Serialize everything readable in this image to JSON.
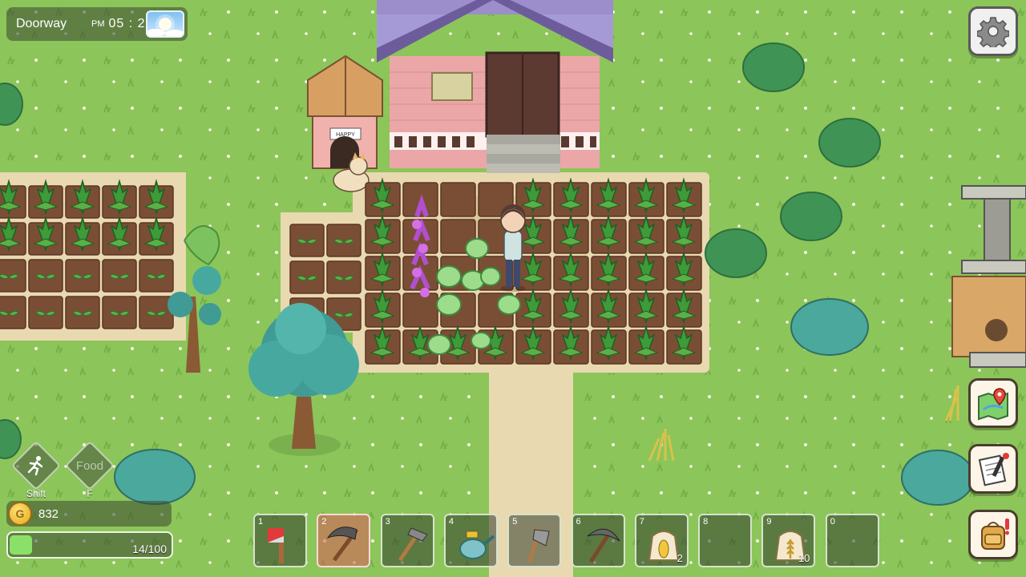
{
  "hud": {
    "location": "Doorway",
    "ampm": "PM",
    "time": "05 : 20",
    "weather_icon": "sunny-icon",
    "gold": "832",
    "stamina_text": "14/100",
    "stamina_fraction": 0.14
  },
  "actions": {
    "run_key": "Shift",
    "food_label": "Food",
    "food_key": "F"
  },
  "house": {
    "sign_text": "HAPPY"
  },
  "side_buttons": [
    "settings-icon",
    "map-icon",
    "journal-icon",
    "backpack-icon"
  ],
  "hotbar": {
    "slots": [
      {
        "num": "1",
        "item": "fire-axe",
        "count": ""
      },
      {
        "num": "2",
        "item": "scythe",
        "count": ""
      },
      {
        "num": "3",
        "item": "hoe",
        "count": ""
      },
      {
        "num": "4",
        "item": "watering-can",
        "count": ""
      },
      {
        "num": "5",
        "item": "axe",
        "count": ""
      },
      {
        "num": "6",
        "item": "pickaxe",
        "count": ""
      },
      {
        "num": "7",
        "item": "corn-seed-bag",
        "count": "2"
      },
      {
        "num": "8",
        "item": "",
        "count": ""
      },
      {
        "num": "9",
        "item": "wheat-seed-bag",
        "count": "10"
      },
      {
        "num": "0",
        "item": "",
        "count": ""
      }
    ],
    "active_index": 1
  },
  "colors": {
    "grass": "#8cc55a",
    "path": "#e9d9b0",
    "soil": "#7a4e35",
    "tree": "#3f9b93"
  }
}
